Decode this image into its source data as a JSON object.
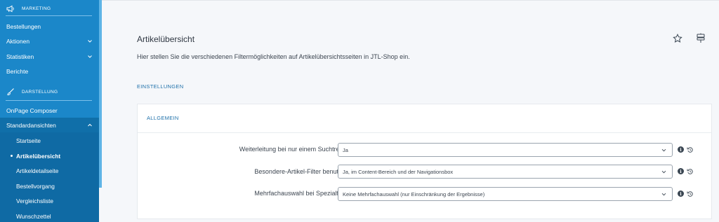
{
  "sidebar": {
    "sections": [
      {
        "label": "MARKETING",
        "icon": "megaphone-icon"
      },
      {
        "label": "DARSTELLUNG",
        "icon": "brush-icon"
      }
    ],
    "items": [
      {
        "label": "Bestellungen"
      },
      {
        "label": "Aktionen",
        "expandable": true
      },
      {
        "label": "Statistiken",
        "expandable": true
      },
      {
        "label": "Berichte"
      },
      {
        "label": "OnPage Composer"
      },
      {
        "label": "Standardansichten",
        "expanded": true
      }
    ],
    "subitems": [
      {
        "label": "Startseite"
      },
      {
        "label": "Artikelübersicht",
        "active": true
      },
      {
        "label": "Artikeldetailseite"
      },
      {
        "label": "Bestellvorgang"
      },
      {
        "label": "Vergleichsliste"
      },
      {
        "label": "Wunschzettel"
      }
    ]
  },
  "main": {
    "title": "Artikelübersicht",
    "description": "Hier stellen Sie die verschiedenen Filtermöglichkeiten auf Artikelübersichtsseiten in JTL-Shop ein.",
    "section_label": "EINSTELLUNGEN",
    "card": {
      "title": "ALLGEMEIN",
      "rows": [
        {
          "label": "Weiterleitung bei nur einem Suchtreffer:",
          "value": "Ja"
        },
        {
          "label": "Besondere-Artikel-Filter benutzen:",
          "value": "Ja, im Content-Bereich und der Navigationsbox"
        },
        {
          "label": "Mehrfachauswahl bei Spezialfilter:",
          "value": "Keine Mehrfachauswahl (nur Einschränkung der Ergebnisse)"
        }
      ]
    }
  },
  "icons": {
    "info": "i"
  },
  "colors": {
    "sidebar": "#1b87c9",
    "sidebar_dark": "#0f6aa4",
    "accent_text": "#1f71aa"
  }
}
